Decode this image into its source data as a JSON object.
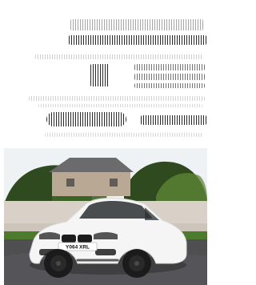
{
  "colors": {
    "background": "#ffffff",
    "sky": "#eef2f5",
    "tree_dark": "#2f4a1e",
    "tree_mid": "#3f6526",
    "tree_light": "#5f8a35",
    "house_roof": "#6b6b6b",
    "house_wall": "#b8a894",
    "wall": "#d9d1c7",
    "grass": "#4d7a2c",
    "road": "#4f4f52",
    "car_body": "#f5f5f5",
    "wheel": "#1b1b1c",
    "plate_text": "#111111"
  },
  "icons": {
    "car_photo": "car-photo"
  },
  "photo": {
    "plate_text": "Y064 XRL"
  }
}
